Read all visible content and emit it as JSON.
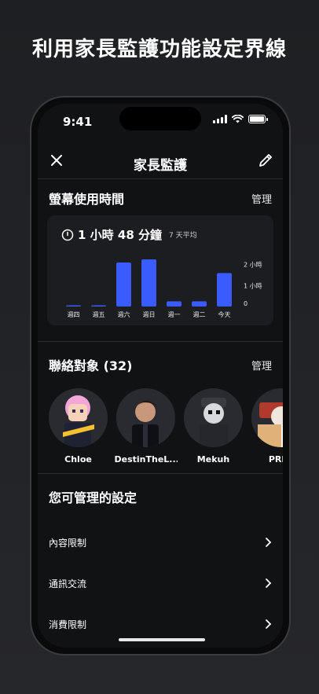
{
  "promo": {
    "title": "利用家長監護功能設定界線"
  },
  "status_bar": {
    "time": "9:41"
  },
  "nav": {
    "title": "家長監護"
  },
  "screen_time": {
    "title": "螢幕使用時間",
    "manage": "管理",
    "total": "1 小時 48 分鐘",
    "average_label": "7 天平均"
  },
  "chart_data": {
    "type": "bar",
    "categories": [
      "週四",
      "週五",
      "週六",
      "週日",
      "週一",
      "週二",
      "今天"
    ],
    "values": [
      0.02,
      0.02,
      2.1,
      2.25,
      0.25,
      0.25,
      1.6
    ],
    "ytick_labels": [
      "2 小時",
      "1 小時",
      "0"
    ],
    "ytick_values": [
      2,
      1,
      0
    ],
    "ylim": [
      0,
      2.4
    ],
    "bar_color": "#3a5cff"
  },
  "contacts": {
    "title": "聯絡對象 (32)",
    "manage": "管理",
    "items": [
      {
        "name": "Chloe"
      },
      {
        "name": "DestinTheL..."
      },
      {
        "name": "Mekuh"
      },
      {
        "name": "PRLu"
      }
    ]
  },
  "settings": {
    "title": "您可管理的設定",
    "items": [
      {
        "label": "內容限制"
      },
      {
        "label": "通訊交流"
      },
      {
        "label": "消費限制"
      }
    ]
  },
  "colors": {
    "background": "#1e1f22",
    "card": "#1c1d21",
    "accent": "#3a5cff"
  },
  "icons": {
    "close": "close-icon",
    "edit": "pencil-icon",
    "clock": "clock-icon",
    "chevron": "chevron-right-icon"
  }
}
